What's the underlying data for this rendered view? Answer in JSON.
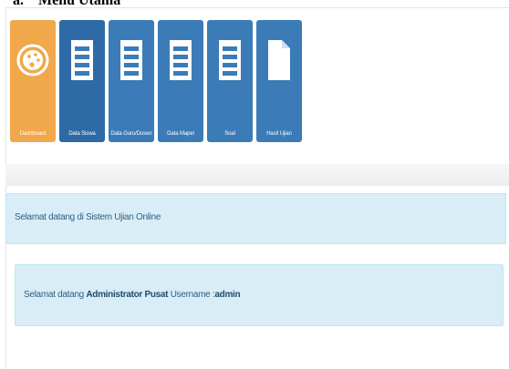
{
  "caption": {
    "number": "a.",
    "title": "Menu Utama"
  },
  "menu": {
    "items": [
      {
        "label": "Dashboard",
        "icon": "palette-icon",
        "color": "#f0a84b"
      },
      {
        "label": "Data Siswa",
        "icon": "list-document-icon",
        "color": "#2e6aa5"
      },
      {
        "label": "Data Guru/Dosen",
        "icon": "list-document-icon",
        "color": "#3a7bb8"
      },
      {
        "label": "Data Mapel",
        "icon": "list-document-icon",
        "color": "#3a7bb8"
      },
      {
        "label": "Soal",
        "icon": "list-document-icon",
        "color": "#3a7bb8"
      },
      {
        "label": "Hasil Ujian",
        "icon": "document-icon",
        "color": "#3a7bb8"
      }
    ]
  },
  "welcome_bar": {
    "text": "Selamat datang di Sistem Ujian Online"
  },
  "info_box": {
    "prefix": "Selamat datang",
    "role": "Administrator Pusat",
    "username_label": "Username :",
    "username": "admin"
  },
  "colors": {
    "info_bg": "#d9edf7",
    "info_border": "#bce8f1",
    "tile_blue": "#3a7bb8",
    "tile_orange": "#f0a84b"
  }
}
